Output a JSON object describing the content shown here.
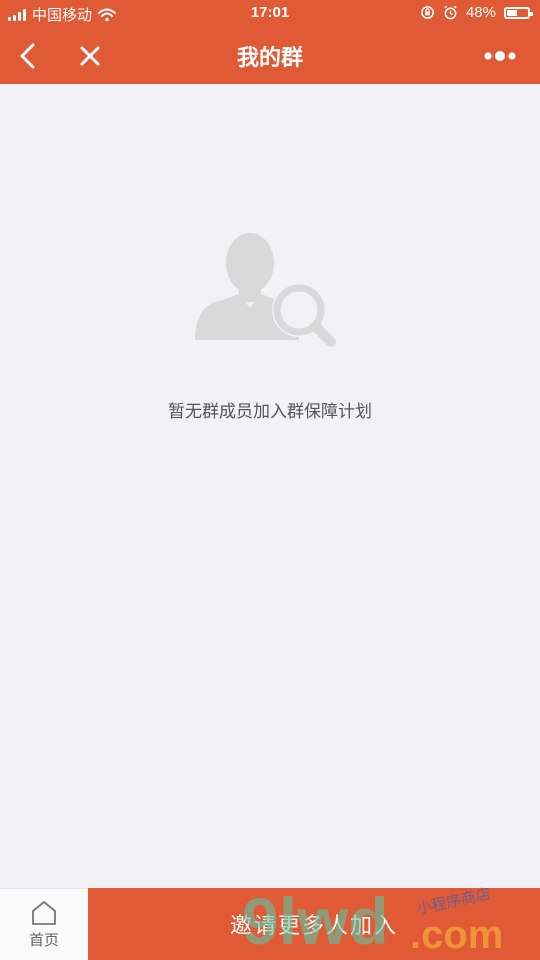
{
  "status_bar": {
    "carrier": "中国移动",
    "time": "17:01",
    "battery_percent": "48%",
    "battery_level": 0.48,
    "icons": [
      "signal-icon",
      "wifi-icon",
      "lock-rotation-icon",
      "alarm-icon",
      "battery-icon"
    ]
  },
  "nav": {
    "title": "我的群",
    "back_icon": "chevron-left-icon",
    "close_icon": "close-icon",
    "more_icon": "more-dots-icon"
  },
  "empty_state": {
    "icon": "user-search-icon",
    "message": "暂无群成员加入群保障计划"
  },
  "bottom_bar": {
    "home_label": "首页",
    "home_icon": "home-icon",
    "invite_label": "邀请更多人加入"
  },
  "watermark": {
    "text_large": "9lwd",
    "text_domain": ".com",
    "text_small": "小程序商店"
  },
  "colors": {
    "accent": "#e05a35",
    "background": "#f2f1f6",
    "text_muted": "#555555"
  }
}
